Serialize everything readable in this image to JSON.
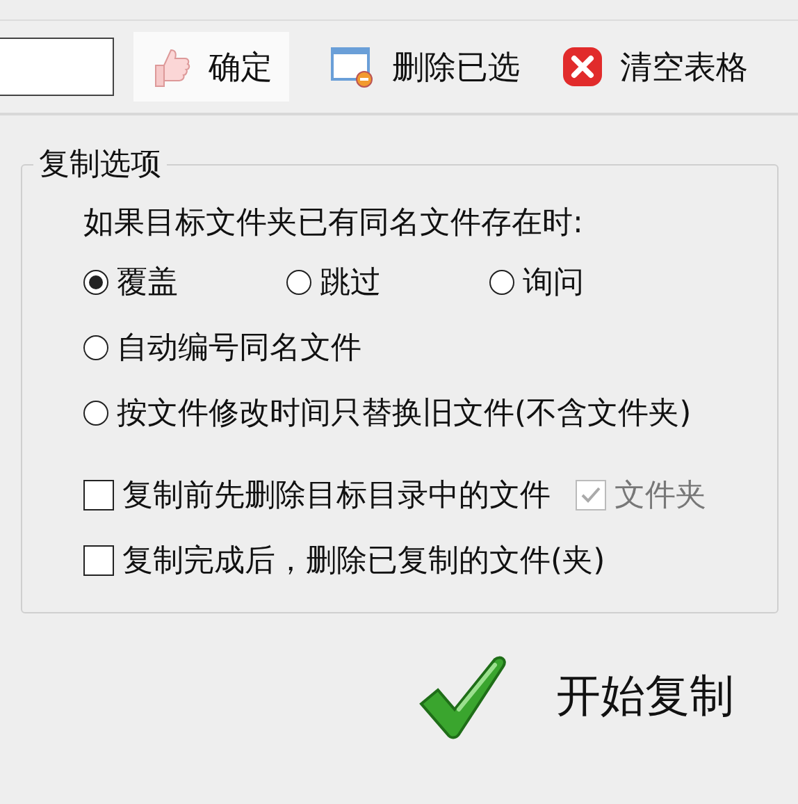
{
  "toolbar": {
    "buttons": [
      {
        "label": "确定",
        "kind": "hand"
      },
      {
        "label": "删除已选",
        "kind": "window"
      },
      {
        "label": "清空表格",
        "kind": "clear"
      }
    ]
  },
  "copy_options": {
    "title": "复制选项",
    "prompt": "如果目标文件夹已有同名文件存在时:",
    "radio_rows": [
      [
        {
          "label": "覆盖",
          "selected": true
        },
        {
          "label": "跳过",
          "selected": false
        },
        {
          "label": "询问",
          "selected": false
        }
      ],
      [
        {
          "label": "自动编号同名文件",
          "selected": false
        }
      ],
      [
        {
          "label": "按文件修改时间只替换旧文件(不含文件夹)",
          "selected": false
        }
      ]
    ],
    "checkbox_rows": [
      [
        {
          "label": "复制前先删除目标目录中的文件",
          "checked": false,
          "disabled": false
        },
        {
          "label": "文件夹",
          "checked": true,
          "disabled": true
        }
      ],
      [
        {
          "label": "复制完成后，删除已复制的文件(夹)",
          "checked": false,
          "disabled": false
        }
      ]
    ]
  },
  "start_button": {
    "label": "开始复制"
  }
}
